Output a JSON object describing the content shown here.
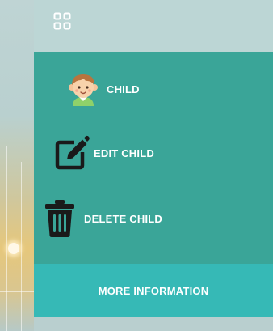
{
  "header": {
    "menu_icon": "grid-icon"
  },
  "menu": {
    "items": [
      {
        "label": "CHILD",
        "icon": "child-avatar-icon"
      },
      {
        "label": "EDIT CHILD",
        "icon": "edit-icon"
      },
      {
        "label": "DELETE CHILD",
        "icon": "trash-icon"
      }
    ]
  },
  "footer": {
    "more_label": "MORE INFORMATION"
  },
  "colors": {
    "panel": "#3aa598",
    "footer_button": "#36b9b6",
    "header": "#bcd6d5",
    "label_text": "#ffffff"
  }
}
